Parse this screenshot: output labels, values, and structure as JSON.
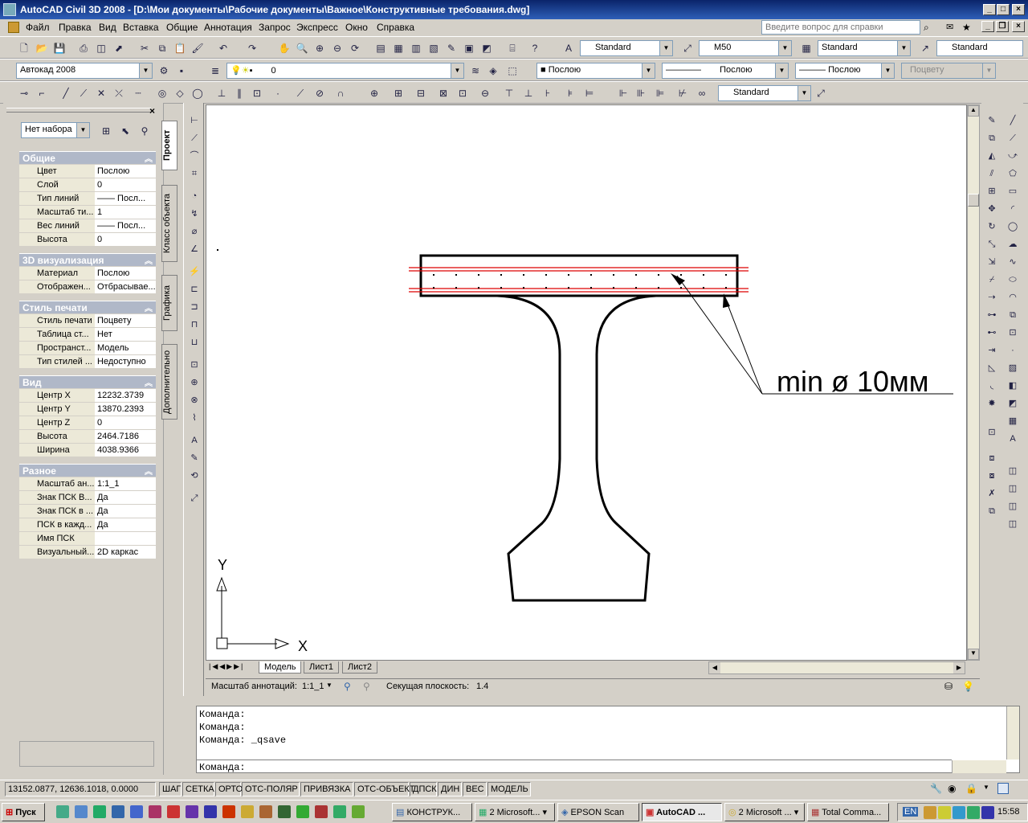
{
  "window": {
    "title": "AutoCAD Civil 3D 2008 - [D:\\Мои документы\\Рабочие документы\\Важное\\Конструктивные требования.dwg]"
  },
  "menu": [
    "Файл",
    "Правка",
    "Вид",
    "Вставка",
    "Общие",
    "Аннотация",
    "Запрос",
    "Экспресс",
    "Окно",
    "Справка"
  ],
  "help_placeholder": "Введите вопрос для справки",
  "toolbar1": {
    "text_style": "Standard",
    "dim_style": "M50",
    "table_style": "Standard",
    "mleader_style": "Standard"
  },
  "toolbar2": {
    "workspace": "Автокад 2008",
    "layer": "0",
    "color": "Послою",
    "linetype": "Послою",
    "lineweight": "Послою",
    "plotstyle": "Поцвету"
  },
  "toolbar3": {
    "dimstyle": "Standard"
  },
  "props": {
    "selection": "Нет набора",
    "sections": [
      {
        "title": "Общие",
        "rows": [
          [
            "Цвет",
            "Послою"
          ],
          [
            "Слой",
            "0"
          ],
          [
            "Тип линий",
            "—— Посл..."
          ],
          [
            "Масштаб ти...",
            "1"
          ],
          [
            "Вес линий",
            "—— Посл..."
          ],
          [
            "Высота",
            "0"
          ]
        ]
      },
      {
        "title": "3D визуализация",
        "rows": [
          [
            "Материал",
            "Послою"
          ],
          [
            "Отображен...",
            "Отбрасывае..."
          ]
        ]
      },
      {
        "title": "Стиль печати",
        "rows": [
          [
            "Стиль печати",
            "Поцвету"
          ],
          [
            "Таблица ст...",
            "Нет"
          ],
          [
            "Пространст...",
            "Модель"
          ],
          [
            "Тип стилей ...",
            "Недоступно"
          ]
        ]
      },
      {
        "title": "Вид",
        "rows": [
          [
            "Центр X",
            "12232.3739"
          ],
          [
            "Центр Y",
            "13870.2393"
          ],
          [
            "Центр Z",
            "0"
          ],
          [
            "Высота",
            "2464.7186"
          ],
          [
            "Ширина",
            "4038.9366"
          ]
        ]
      },
      {
        "title": "Разное",
        "rows": [
          [
            "Масштаб ан...",
            "1:1_1"
          ],
          [
            "Знак ПСК В...",
            "Да"
          ],
          [
            "Знак ПСК в ...",
            "Да"
          ],
          [
            "ПСК в кажд...",
            "Да"
          ],
          [
            "Имя ПСК",
            ""
          ],
          [
            "Визуальный...",
            "2D каркас"
          ]
        ]
      }
    ],
    "tabs": [
      "Проект",
      "Класс объекта",
      "Графика",
      "Дополнительно"
    ]
  },
  "drawing": {
    "annotation": "min  ø  10мм",
    "ucs_x": "X",
    "ucs_y": "Y"
  },
  "layout_tabs": [
    "Модель",
    "Лист1",
    "Лист2"
  ],
  "annbar": {
    "scale_label": "Масштаб аннотаций:",
    "scale_value": "1:1_1",
    "section_label": "Секущая плоскость:",
    "section_value": "1.4"
  },
  "command_lines": [
    "Команда:",
    "Команда:",
    "Команда: _qsave"
  ],
  "command_prompt": "Команда:",
  "status": {
    "coords": "13152.0877, 12636.1018, 0.0000",
    "buttons": [
      "ШАГ",
      "СЕТКА",
      "ОРТО",
      "ОТС-ПОЛЯР",
      "ПРИВЯЗКА",
      "ОТС-ОБЪЕКТ",
      "ДПСК",
      "ДИН",
      "ВЕС",
      "МОДЕЛЬ"
    ]
  },
  "taskbar": {
    "start": "Пуск",
    "tasks": [
      "КОНСТРУК...",
      "2 Microsoft...",
      "EPSON Scan",
      "AutoCAD ...",
      "2 Microsoft ...",
      "Total Comma..."
    ],
    "lang": "EN",
    "time": "15:58"
  }
}
